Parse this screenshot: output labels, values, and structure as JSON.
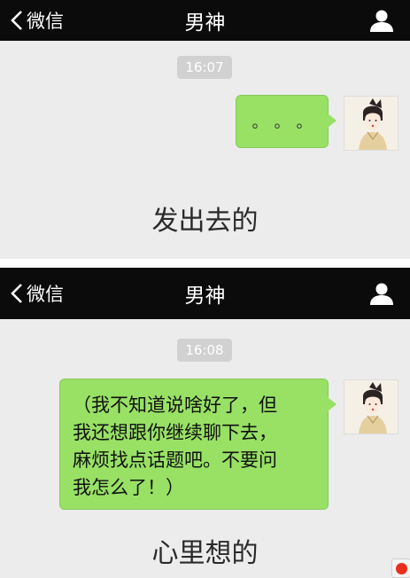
{
  "panels": [
    {
      "header": {
        "back_label": "微信",
        "title": "男神"
      },
      "timestamp": "16:07",
      "message": "。。。",
      "caption": "发出去的"
    },
    {
      "header": {
        "back_label": "微信",
        "title": "男神"
      },
      "timestamp": "16:08",
      "message_lines": [
        "（我不知道说啥好了，但",
        "我还想跟你继续聊下去，",
        "麻烦找点话题吧。不要问",
        "我怎么了！）"
      ],
      "caption": "心里想的"
    }
  ],
  "colors": {
    "header_bg": "#0b0b0b",
    "chat_bg": "#ececec",
    "bubble_green": "#98e165",
    "timestamp_bg": "#d1d1d1",
    "record_red": "#e8301c"
  },
  "icons": {
    "back": "chevron-left-icon",
    "profile": "person-icon",
    "avatar": "avatar-illustration",
    "record": "record-icon"
  }
}
